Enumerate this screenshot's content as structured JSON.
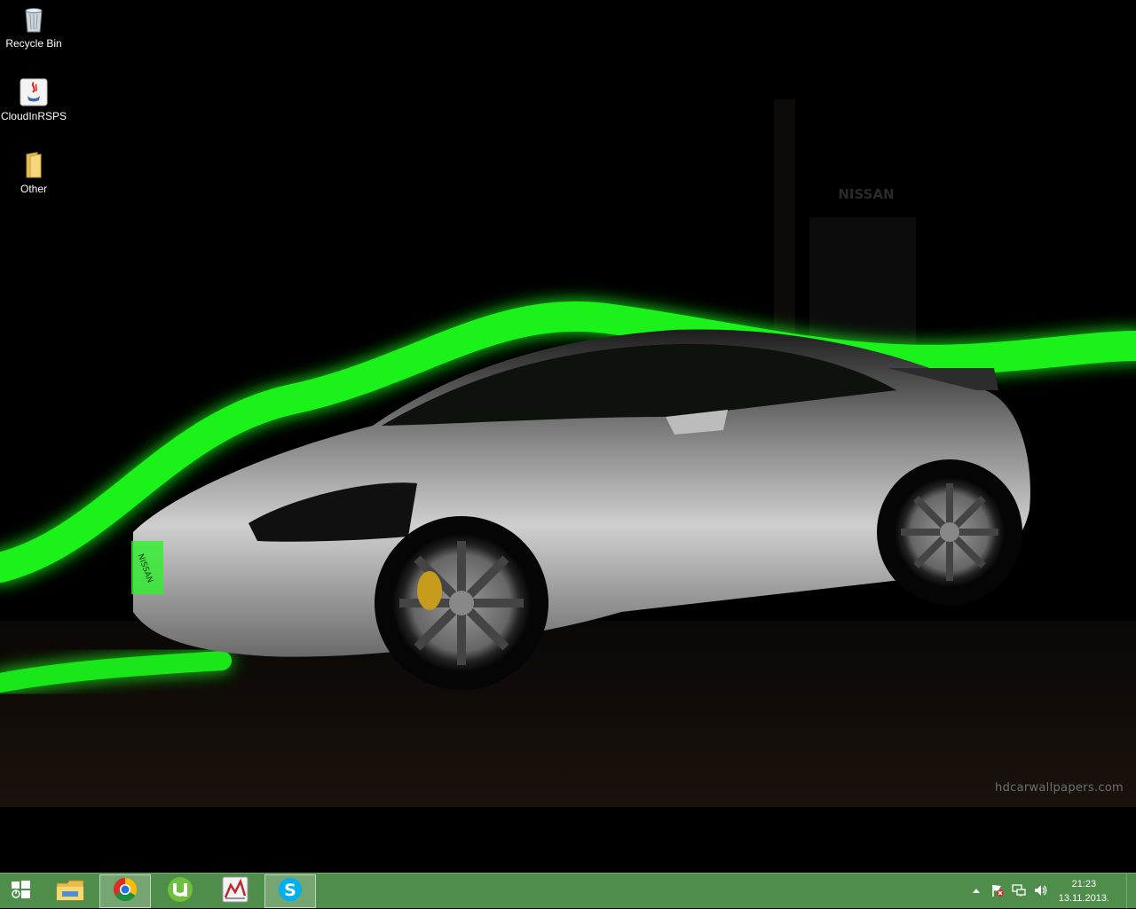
{
  "desktop": {
    "icons": [
      {
        "label": "Recycle Bin",
        "icon": "recycle-bin-icon"
      },
      {
        "label": "CloudInRSPS",
        "icon": "java-icon"
      },
      {
        "label": "Other",
        "icon": "folder-icon"
      }
    ],
    "wallpaper": {
      "brand_sign": "NISSAN",
      "plate": "NISSAN",
      "watermark": "hdcarwallpapers.com",
      "accent_color": "#22ff22"
    }
  },
  "taskbar": {
    "color": "#4f8d4a",
    "start": {
      "icon": "windows-start-icon"
    },
    "pinned": [
      {
        "name": "File Explorer",
        "icon": "file-explorer-icon",
        "active": false
      },
      {
        "name": "Google Chrome",
        "icon": "chrome-icon",
        "active": true
      },
      {
        "name": "uTorrent",
        "icon": "utorrent-icon",
        "active": false
      },
      {
        "name": "Chart app",
        "icon": "chart-app-icon",
        "active": false
      },
      {
        "name": "Skype",
        "icon": "skype-icon",
        "active": true
      }
    ],
    "tray": {
      "icons": [
        "show-hidden-icons-icon",
        "action-center-flag-icon",
        "network-icon",
        "volume-icon"
      ],
      "time": "21:23",
      "date": "13.11.2013."
    }
  }
}
